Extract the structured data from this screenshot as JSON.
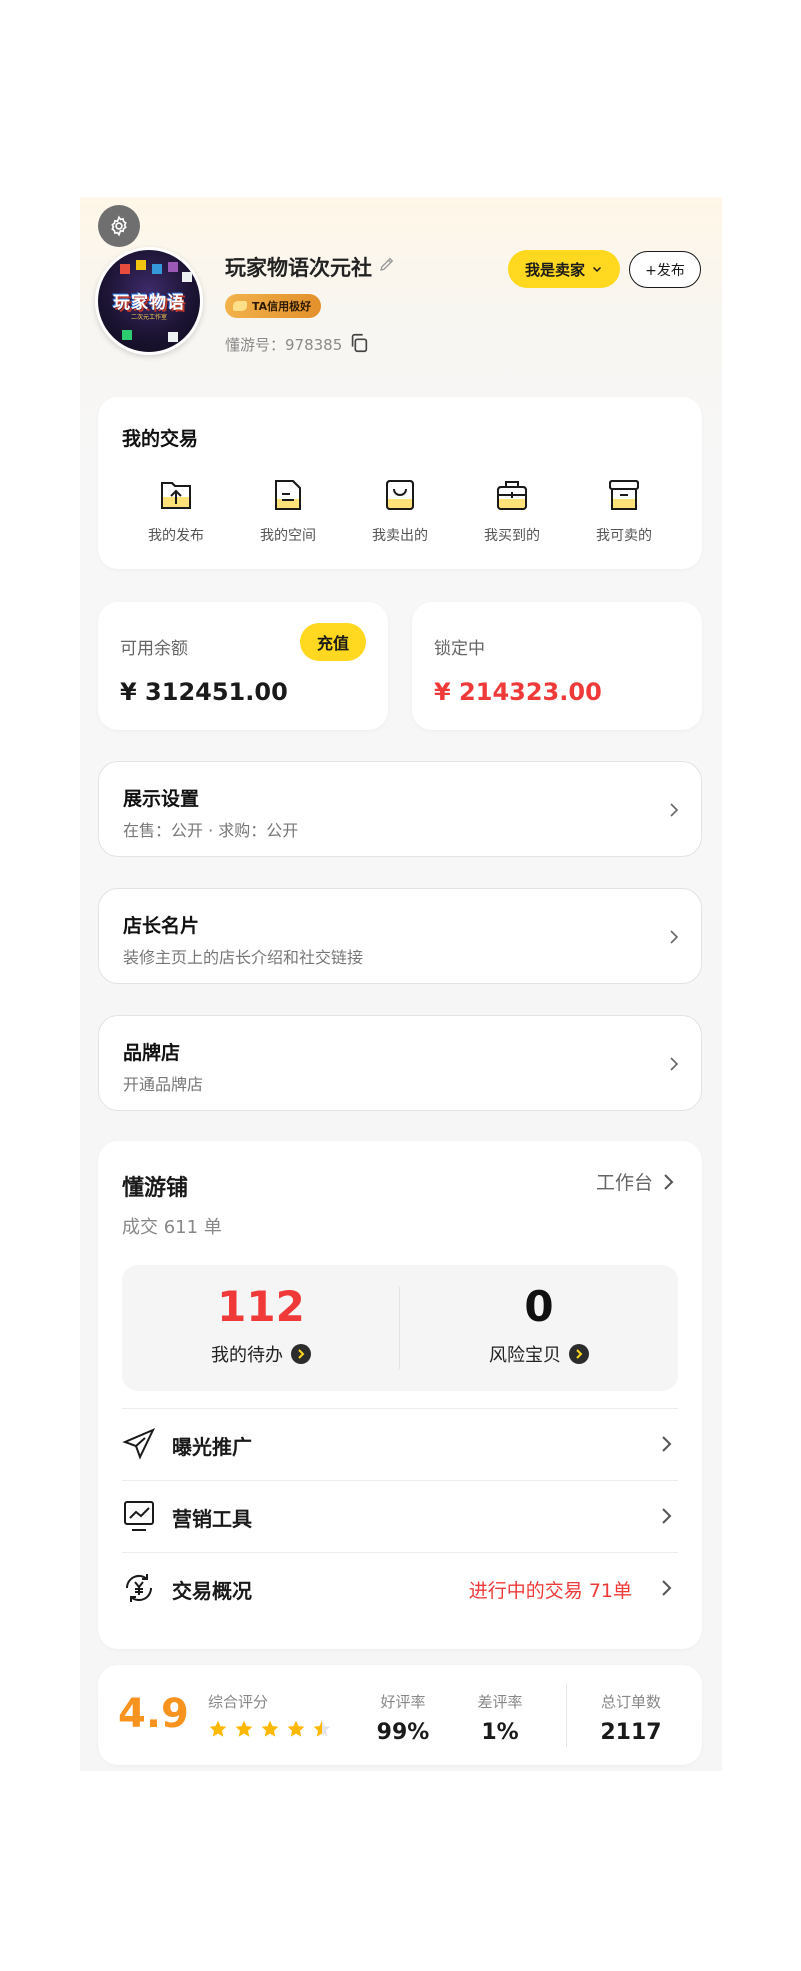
{
  "profile": {
    "nickname": "玩家物语次元社",
    "credit_badge": "TA信用极好",
    "uid": "懂游号：978385",
    "avatar_text": "玩家物语",
    "avatar_subtext": "二次元工作室"
  },
  "header": {
    "seller_button": "我是卖家",
    "publish_button": "+发布"
  },
  "my_trades": {
    "title": "我的交易",
    "items": [
      {
        "label": "我的发布",
        "icon": "upload-folder-icon"
      },
      {
        "label": "我的空间",
        "icon": "document-icon"
      },
      {
        "label": "我卖出的",
        "icon": "shopping-bag-icon"
      },
      {
        "label": "我买到的",
        "icon": "briefcase-icon"
      },
      {
        "label": "我可卖的",
        "icon": "archive-box-icon"
      }
    ]
  },
  "balance": {
    "available_label": "可用余额",
    "available_value": "¥ 312451.00",
    "recharge_button": "充值",
    "locked_label": "锁定中",
    "locked_value": "¥ 214323.00"
  },
  "settings_rows": [
    {
      "title": "展示设置",
      "subtitle": "在售：公开 · 求购：公开"
    },
    {
      "title": "店长名片",
      "subtitle": "装修主页上的店长介绍和社交链接"
    },
    {
      "title": "品牌店",
      "subtitle": "开通品牌店"
    }
  ],
  "shop": {
    "title": "懂游铺",
    "subtitle": "成交 611 单",
    "workbench_link": "工作台",
    "pending_count": "112",
    "pending_label": "我的待办",
    "risk_count": "0",
    "risk_label": "风险宝贝",
    "menu": [
      {
        "label": "曝光推广",
        "icon": "paper-plane-icon",
        "right_text": ""
      },
      {
        "label": "营销工具",
        "icon": "chart-monitor-icon",
        "right_text": ""
      },
      {
        "label": "交易概况",
        "icon": "yen-cycle-icon",
        "right_text": "进行中的交易 71单"
      }
    ]
  },
  "rating": {
    "score": "4.9",
    "score_label": "综合评分",
    "stars": 4.5,
    "good_rate_label": "好评率",
    "good_rate": "99%",
    "bad_rate_label": "差评率",
    "bad_rate": "1%",
    "orders_label": "总订单数",
    "orders": "2117"
  },
  "colors": {
    "accent_yellow": "#ffd81f",
    "price_red": "#f03a3a",
    "rating_orange": "#f7931e"
  }
}
